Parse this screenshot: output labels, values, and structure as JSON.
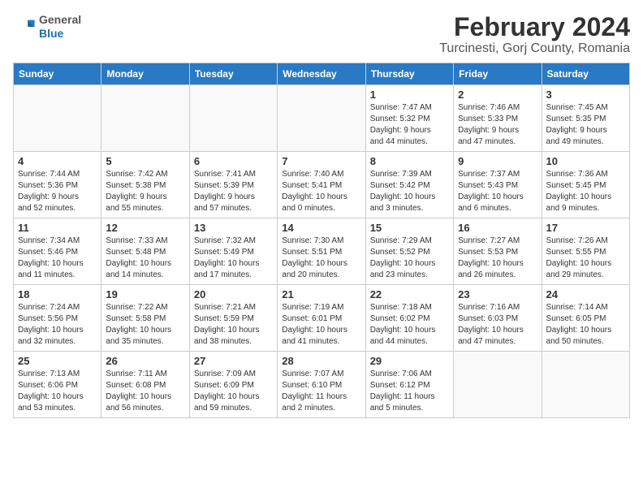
{
  "header": {
    "logo_line1": "General",
    "logo_line2": "Blue",
    "title": "February 2024",
    "subtitle": "Turcinesti, Gorj County, Romania"
  },
  "calendar": {
    "days_of_week": [
      "Sunday",
      "Monday",
      "Tuesday",
      "Wednesday",
      "Thursday",
      "Friday",
      "Saturday"
    ],
    "weeks": [
      [
        {
          "day": "",
          "info": ""
        },
        {
          "day": "",
          "info": ""
        },
        {
          "day": "",
          "info": ""
        },
        {
          "day": "",
          "info": ""
        },
        {
          "day": "1",
          "info": "Sunrise: 7:47 AM\nSunset: 5:32 PM\nDaylight: 9 hours\nand 44 minutes."
        },
        {
          "day": "2",
          "info": "Sunrise: 7:46 AM\nSunset: 5:33 PM\nDaylight: 9 hours\nand 47 minutes."
        },
        {
          "day": "3",
          "info": "Sunrise: 7:45 AM\nSunset: 5:35 PM\nDaylight: 9 hours\nand 49 minutes."
        }
      ],
      [
        {
          "day": "4",
          "info": "Sunrise: 7:44 AM\nSunset: 5:36 PM\nDaylight: 9 hours\nand 52 minutes."
        },
        {
          "day": "5",
          "info": "Sunrise: 7:42 AM\nSunset: 5:38 PM\nDaylight: 9 hours\nand 55 minutes."
        },
        {
          "day": "6",
          "info": "Sunrise: 7:41 AM\nSunset: 5:39 PM\nDaylight: 9 hours\nand 57 minutes."
        },
        {
          "day": "7",
          "info": "Sunrise: 7:40 AM\nSunset: 5:41 PM\nDaylight: 10 hours\nand 0 minutes."
        },
        {
          "day": "8",
          "info": "Sunrise: 7:39 AM\nSunset: 5:42 PM\nDaylight: 10 hours\nand 3 minutes."
        },
        {
          "day": "9",
          "info": "Sunrise: 7:37 AM\nSunset: 5:43 PM\nDaylight: 10 hours\nand 6 minutes."
        },
        {
          "day": "10",
          "info": "Sunrise: 7:36 AM\nSunset: 5:45 PM\nDaylight: 10 hours\nand 9 minutes."
        }
      ],
      [
        {
          "day": "11",
          "info": "Sunrise: 7:34 AM\nSunset: 5:46 PM\nDaylight: 10 hours\nand 11 minutes."
        },
        {
          "day": "12",
          "info": "Sunrise: 7:33 AM\nSunset: 5:48 PM\nDaylight: 10 hours\nand 14 minutes."
        },
        {
          "day": "13",
          "info": "Sunrise: 7:32 AM\nSunset: 5:49 PM\nDaylight: 10 hours\nand 17 minutes."
        },
        {
          "day": "14",
          "info": "Sunrise: 7:30 AM\nSunset: 5:51 PM\nDaylight: 10 hours\nand 20 minutes."
        },
        {
          "day": "15",
          "info": "Sunrise: 7:29 AM\nSunset: 5:52 PM\nDaylight: 10 hours\nand 23 minutes."
        },
        {
          "day": "16",
          "info": "Sunrise: 7:27 AM\nSunset: 5:53 PM\nDaylight: 10 hours\nand 26 minutes."
        },
        {
          "day": "17",
          "info": "Sunrise: 7:26 AM\nSunset: 5:55 PM\nDaylight: 10 hours\nand 29 minutes."
        }
      ],
      [
        {
          "day": "18",
          "info": "Sunrise: 7:24 AM\nSunset: 5:56 PM\nDaylight: 10 hours\nand 32 minutes."
        },
        {
          "day": "19",
          "info": "Sunrise: 7:22 AM\nSunset: 5:58 PM\nDaylight: 10 hours\nand 35 minutes."
        },
        {
          "day": "20",
          "info": "Sunrise: 7:21 AM\nSunset: 5:59 PM\nDaylight: 10 hours\nand 38 minutes."
        },
        {
          "day": "21",
          "info": "Sunrise: 7:19 AM\nSunset: 6:01 PM\nDaylight: 10 hours\nand 41 minutes."
        },
        {
          "day": "22",
          "info": "Sunrise: 7:18 AM\nSunset: 6:02 PM\nDaylight: 10 hours\nand 44 minutes."
        },
        {
          "day": "23",
          "info": "Sunrise: 7:16 AM\nSunset: 6:03 PM\nDaylight: 10 hours\nand 47 minutes."
        },
        {
          "day": "24",
          "info": "Sunrise: 7:14 AM\nSunset: 6:05 PM\nDaylight: 10 hours\nand 50 minutes."
        }
      ],
      [
        {
          "day": "25",
          "info": "Sunrise: 7:13 AM\nSunset: 6:06 PM\nDaylight: 10 hours\nand 53 minutes."
        },
        {
          "day": "26",
          "info": "Sunrise: 7:11 AM\nSunset: 6:08 PM\nDaylight: 10 hours\nand 56 minutes."
        },
        {
          "day": "27",
          "info": "Sunrise: 7:09 AM\nSunset: 6:09 PM\nDaylight: 10 hours\nand 59 minutes."
        },
        {
          "day": "28",
          "info": "Sunrise: 7:07 AM\nSunset: 6:10 PM\nDaylight: 11 hours\nand 2 minutes."
        },
        {
          "day": "29",
          "info": "Sunrise: 7:06 AM\nSunset: 6:12 PM\nDaylight: 11 hours\nand 5 minutes."
        },
        {
          "day": "",
          "info": ""
        },
        {
          "day": "",
          "info": ""
        }
      ]
    ]
  }
}
